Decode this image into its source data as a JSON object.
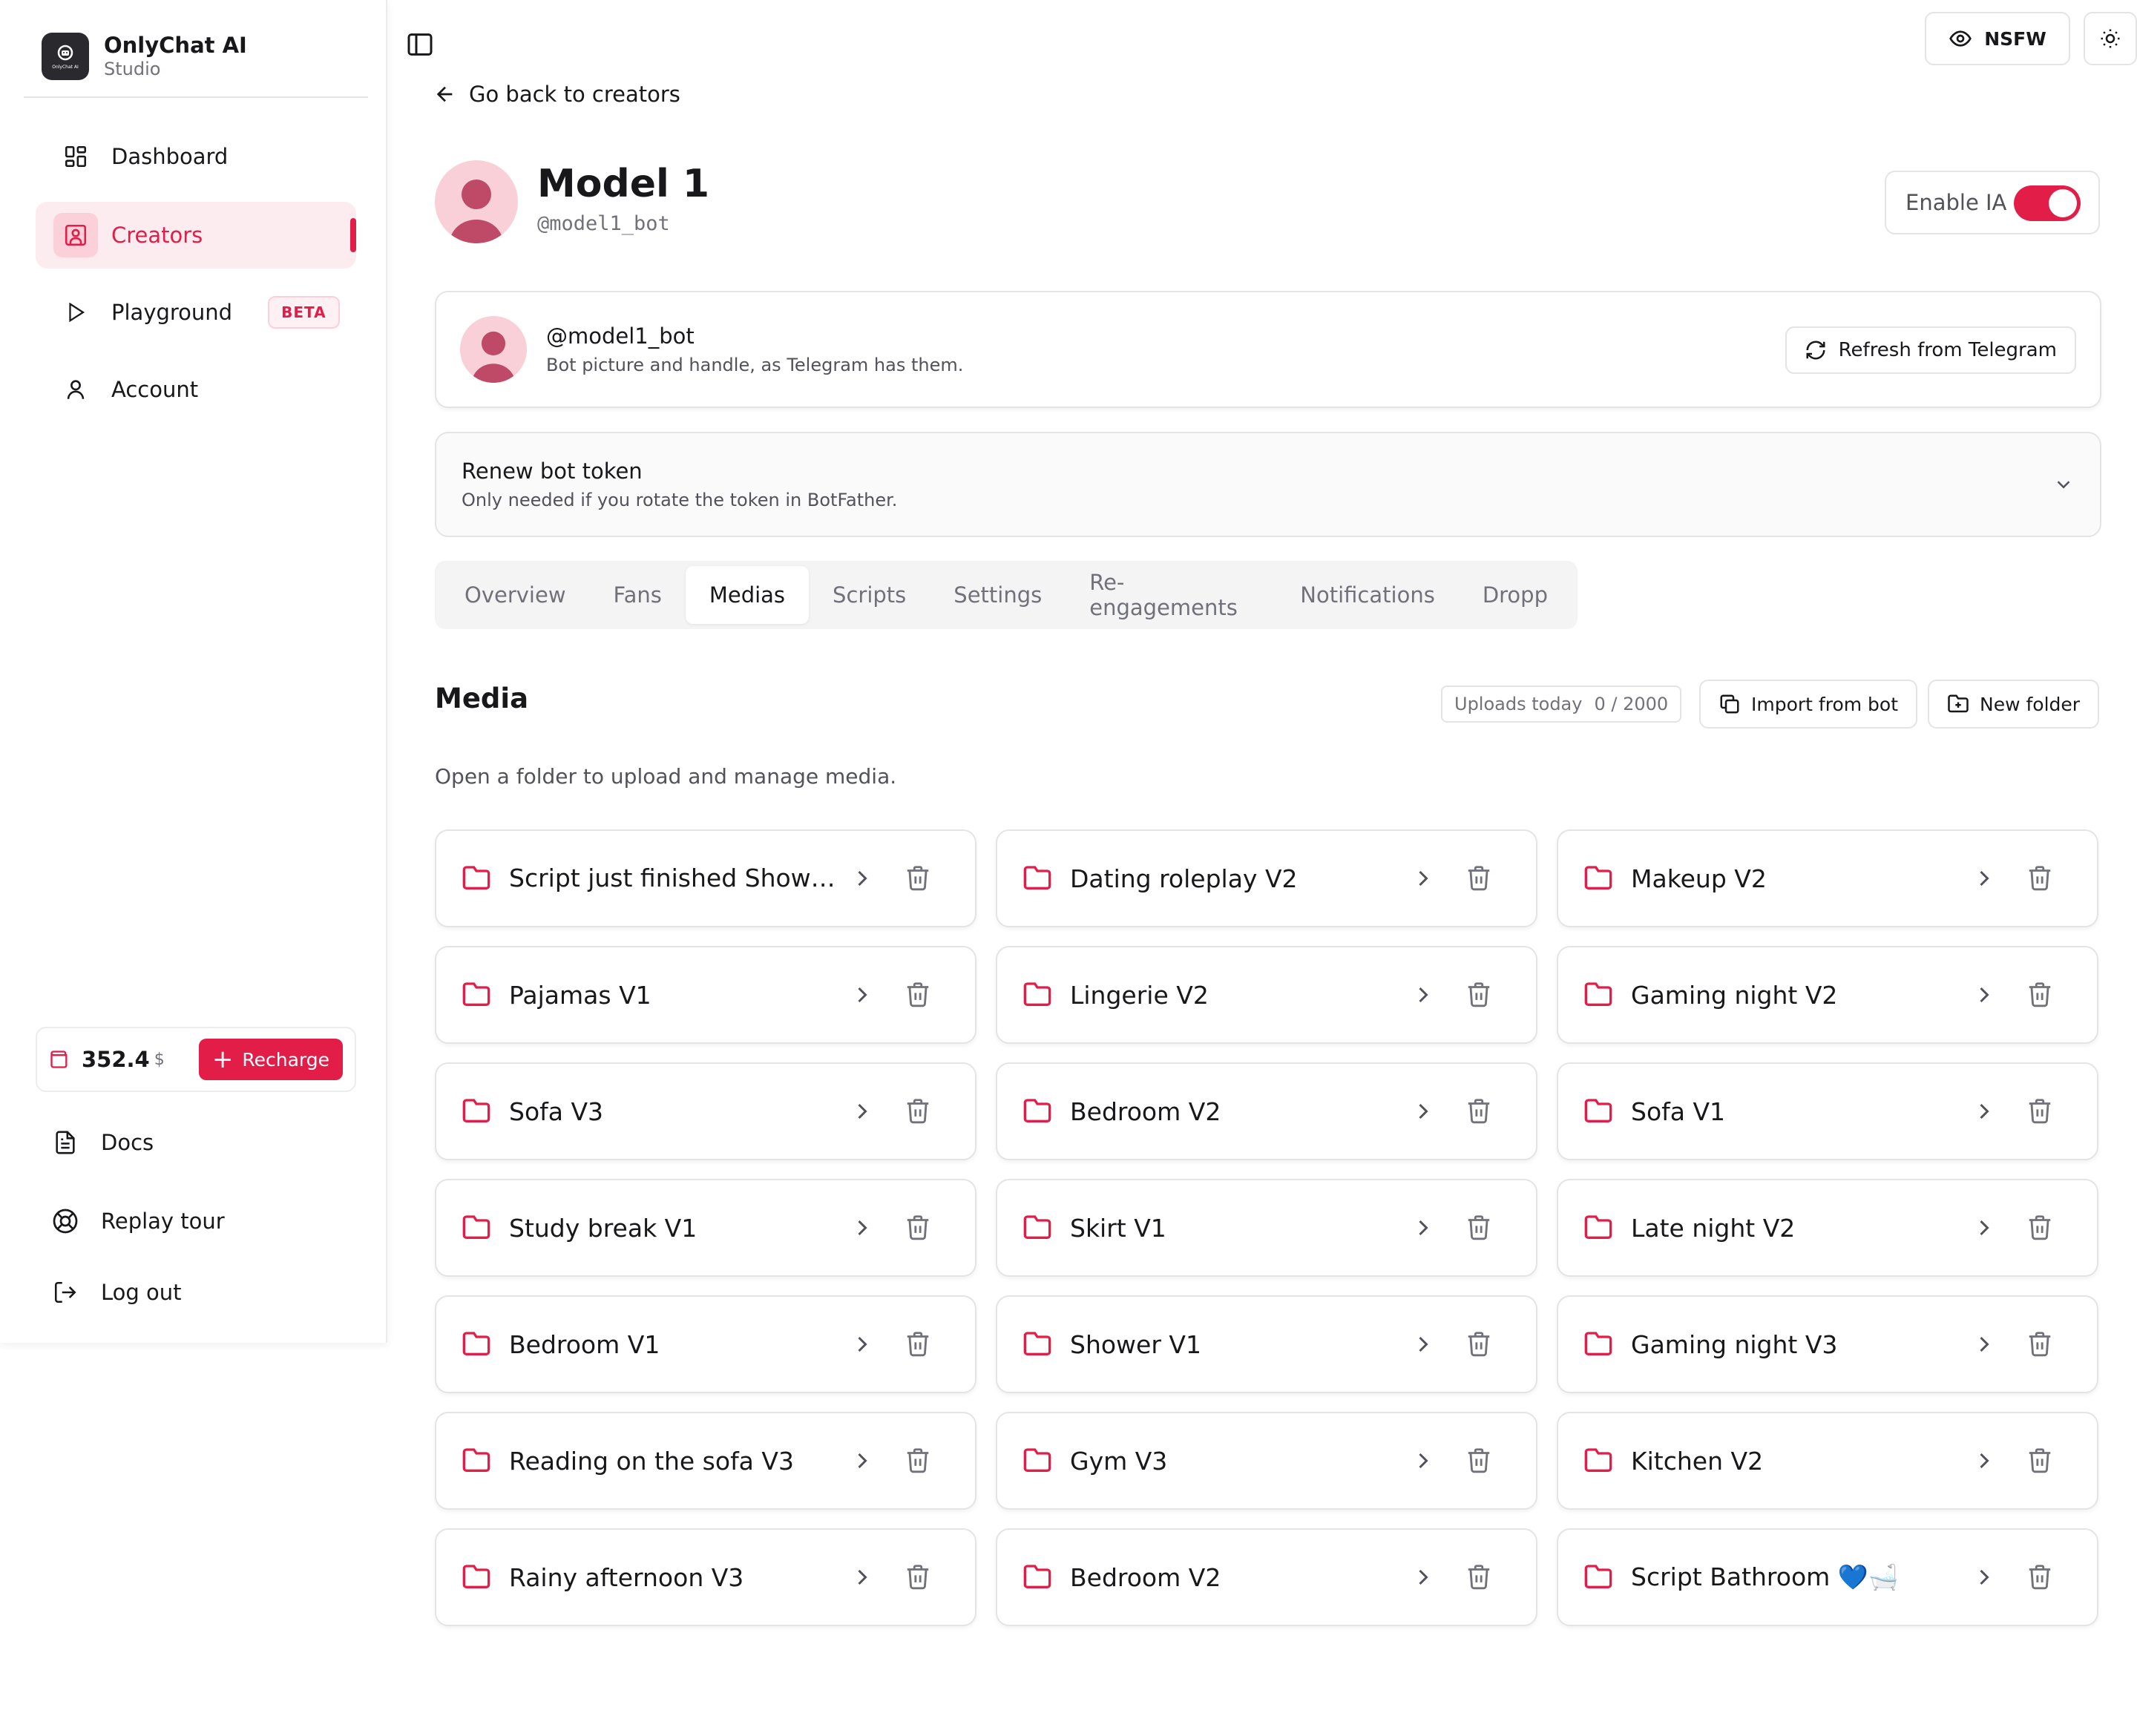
{
  "brand": {
    "name": "OnlyChat AI",
    "subtitle": "Studio",
    "logo_text": "OnlyChat AI"
  },
  "sidebar": {
    "items": [
      {
        "label": "Dashboard",
        "icon": "layout-grid-icon"
      },
      {
        "label": "Creators",
        "icon": "user-square-icon",
        "active": true
      },
      {
        "label": "Playground",
        "icon": "play-icon",
        "badge": "BETA"
      },
      {
        "label": "Account",
        "icon": "user-icon"
      }
    ],
    "wallet": {
      "amount": "352.4",
      "currency": "$",
      "recharge_label": "Recharge"
    },
    "bottom": [
      {
        "label": "Docs",
        "icon": "file-text-icon"
      },
      {
        "label": "Replay tour",
        "icon": "life-buoy-icon"
      },
      {
        "label": "Log out",
        "icon": "log-out-icon"
      }
    ]
  },
  "header": {
    "nsfw_label": "NSFW",
    "back_label": "Go back to creators"
  },
  "creator": {
    "name": "Model 1",
    "handle": "@model1_bot",
    "enable_label": "Enable IA",
    "enabled": true
  },
  "bot_card": {
    "handle": "@model1_bot",
    "description": "Bot picture and handle, as Telegram has them.",
    "refresh_label": "Refresh from Telegram"
  },
  "renew": {
    "title": "Renew bot token",
    "description": "Only needed if you rotate the token in BotFather."
  },
  "tabs": [
    "Overview",
    "Fans",
    "Medias",
    "Scripts",
    "Settings",
    "Re-engagements",
    "Notifications",
    "Dropp"
  ],
  "active_tab": "Medias",
  "media": {
    "title": "Media",
    "uploads_label": "Uploads today",
    "uploads_value": "0 / 2000",
    "import_label": "Import from bot",
    "new_folder_label": "New folder",
    "hint": "Open a folder to upload and manage media.",
    "folders": [
      "Script just finished Shower 🚿",
      "Dating roleplay V2",
      "Makeup V2",
      "Pajamas V1",
      "Lingerie V2",
      "Gaming night V2",
      "Sofa V3",
      "Bedroom V2",
      "Sofa V1",
      "Study break V1",
      "Skirt V1",
      "Late night V2",
      "Bedroom V1",
      "Shower V1",
      "Gaming night V3",
      "Reading on the sofa V3",
      "Gym V3",
      "Kitchen V2",
      "Rainy afternoon V3",
      "Bedroom V2",
      "Script Bathroom 💙🛁"
    ]
  },
  "colors": {
    "accent": "#e11d48",
    "accent_soft": "#fdecef",
    "border": "#e4e4e7",
    "muted": "#71717a"
  }
}
